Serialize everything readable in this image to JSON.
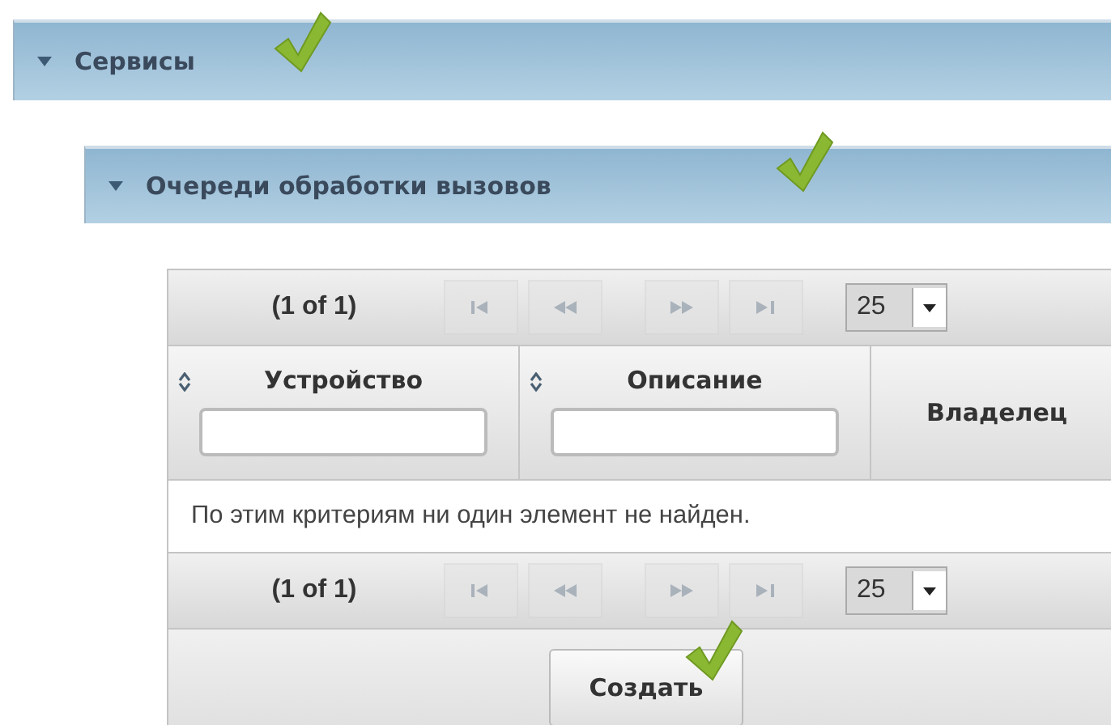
{
  "panels": [
    {
      "title": "Сервисы",
      "expanded": true,
      "checked": true
    },
    {
      "title": "Очереди обработки вызовов",
      "expanded": true,
      "checked": true
    }
  ],
  "paginator_top": {
    "page": "(1 of 1)",
    "buttons": [
      {
        "kind": "first",
        "disabled": true
      },
      {
        "kind": "prev",
        "disabled": true
      },
      {
        "kind": "next",
        "disabled": true
      },
      {
        "kind": "last",
        "disabled": true
      }
    ],
    "rows_per_page": "25"
  },
  "table": {
    "columns": [
      {
        "label": "Устройство",
        "sortable": true,
        "filter": true
      },
      {
        "label": "Описание",
        "sortable": true,
        "filter": true
      },
      {
        "label": "Владелец",
        "sortable": false,
        "filter": false
      }
    ],
    "empty_message": "По этим критериям ни один элемент не найден."
  },
  "paginator_bottom": {
    "page": "(1 of 1)",
    "buttons": [
      {
        "kind": "first",
        "disabled": true
      },
      {
        "kind": "prev",
        "disabled": true
      },
      {
        "kind": "next",
        "disabled": true
      },
      {
        "kind": "last",
        "disabled": true
      }
    ],
    "rows_per_page": "25"
  },
  "footer": {
    "button": "Создать",
    "checked": true
  }
}
